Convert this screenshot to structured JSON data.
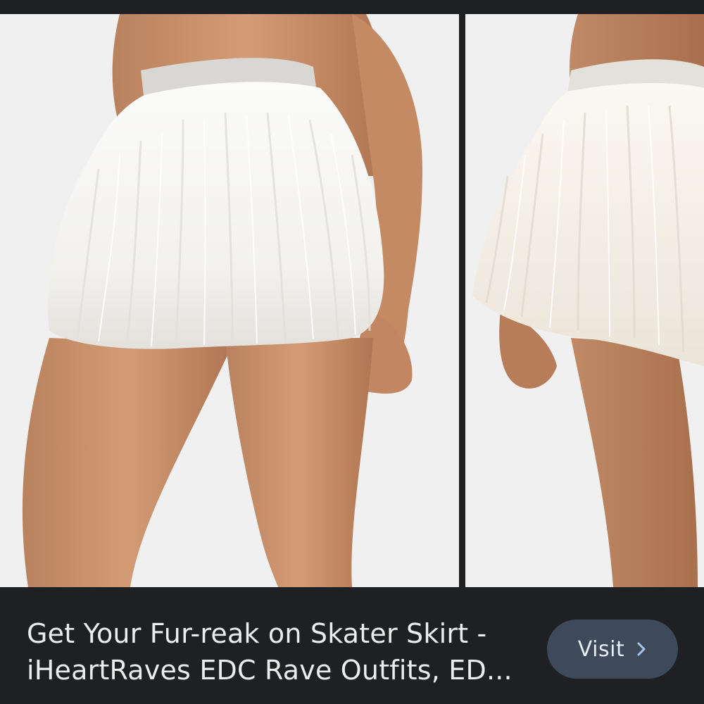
{
  "result": {
    "title_line1": "Get Your Fur-reak on Skater Skirt -",
    "title_line2": "iHeartRaves EDC Rave Outfits, ED...",
    "visit_label": "Visit",
    "visit_icon": "chevron-right-icon"
  },
  "colors": {
    "background": "#1f2023",
    "button": "#3e4a5a",
    "button_text": "#e7edf5",
    "chevron": "#a9c3ee",
    "title_text": "#eceded"
  }
}
